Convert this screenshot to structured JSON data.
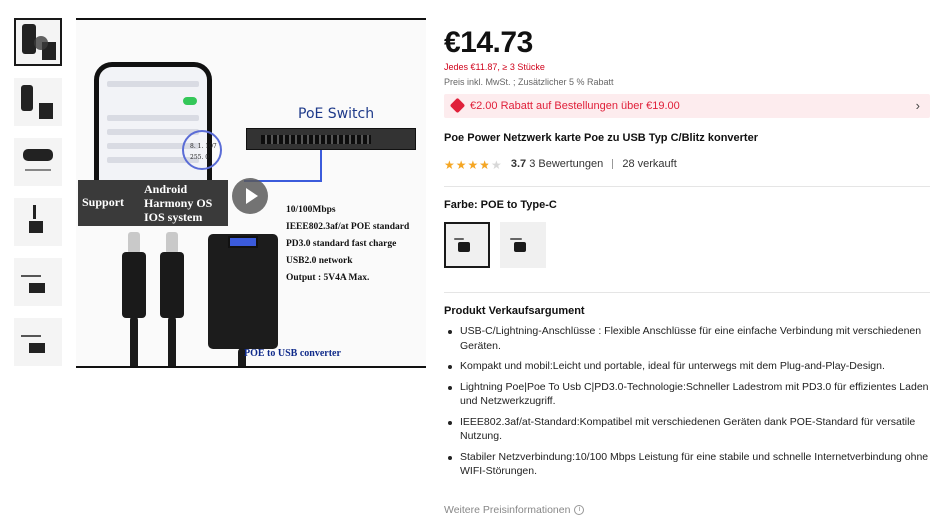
{
  "gallery": {
    "thumbnail_count": 6,
    "active_index": 0,
    "main_image": {
      "switch_label": "PoE Switch",
      "support_label": "Support",
      "os_lines": [
        "Android",
        "Harmony OS",
        "IOS system"
      ],
      "specs": [
        "10/100Mbps",
        "IEEE802.3af/at  POE standard",
        "PD3.0 standard fast charge",
        "USB2.0 network",
        "Output : 5V4A  Max."
      ],
      "converter_label": "POE to USB converter",
      "phone_ip": "8. 1. 107",
      "phone_mask": "255. 0"
    }
  },
  "product": {
    "price": "€14.73",
    "bulk_price": "Jedes €11.87, ≥ 3 Stücke",
    "tax_note": "Preis inkl. MwSt. ; Zusätzlicher 5 % Rabatt",
    "coupon_text": "€2.00 Rabatt auf Bestellungen über €19.00",
    "title": "Poe Power Netzwerk karte Poe zu USB Typ C/Blitz konverter",
    "rating_value": "3.7",
    "rating_fraction": 0.74,
    "reviews": "3 Bewertungen",
    "sold": "28 verkauft"
  },
  "variant": {
    "label": "Farbe: POE to Type-C",
    "selected_index": 0,
    "options_count": 2
  },
  "selling_points": {
    "heading": "Produkt Verkaufsargument",
    "items": [
      "USB-C/Lightning-Anschlüsse : Flexible Anschlüsse für eine einfache Verbindung mit verschiedenen Geräten.",
      "Kompakt und mobil:Leicht und portable, ideal für unterwegs mit dem Plug-and-Play-Design.",
      "Lightning Poe|Poe To Usb C|PD3.0-Technologie:Schneller Ladestrom mit PD3.0 für effizientes Laden und Netzwerkzugriff.",
      "IEEE802.3af/at-Standard:Kompatibel mit verschiedenen Geräten dank POE-Standard für versatile Nutzung.",
      "Stabiler Netzverbindung:10/100 Mbps Leistung für eine stabile und schnelle Internetverbindung ohne WIFI-Störungen."
    ]
  },
  "footer": {
    "more_info": "Weitere Preisinformationen",
    "info_glyph": "i"
  },
  "colors": {
    "price_red": "#d0021b",
    "coupon_bg": "#fdecee",
    "star": "#f5a623"
  }
}
